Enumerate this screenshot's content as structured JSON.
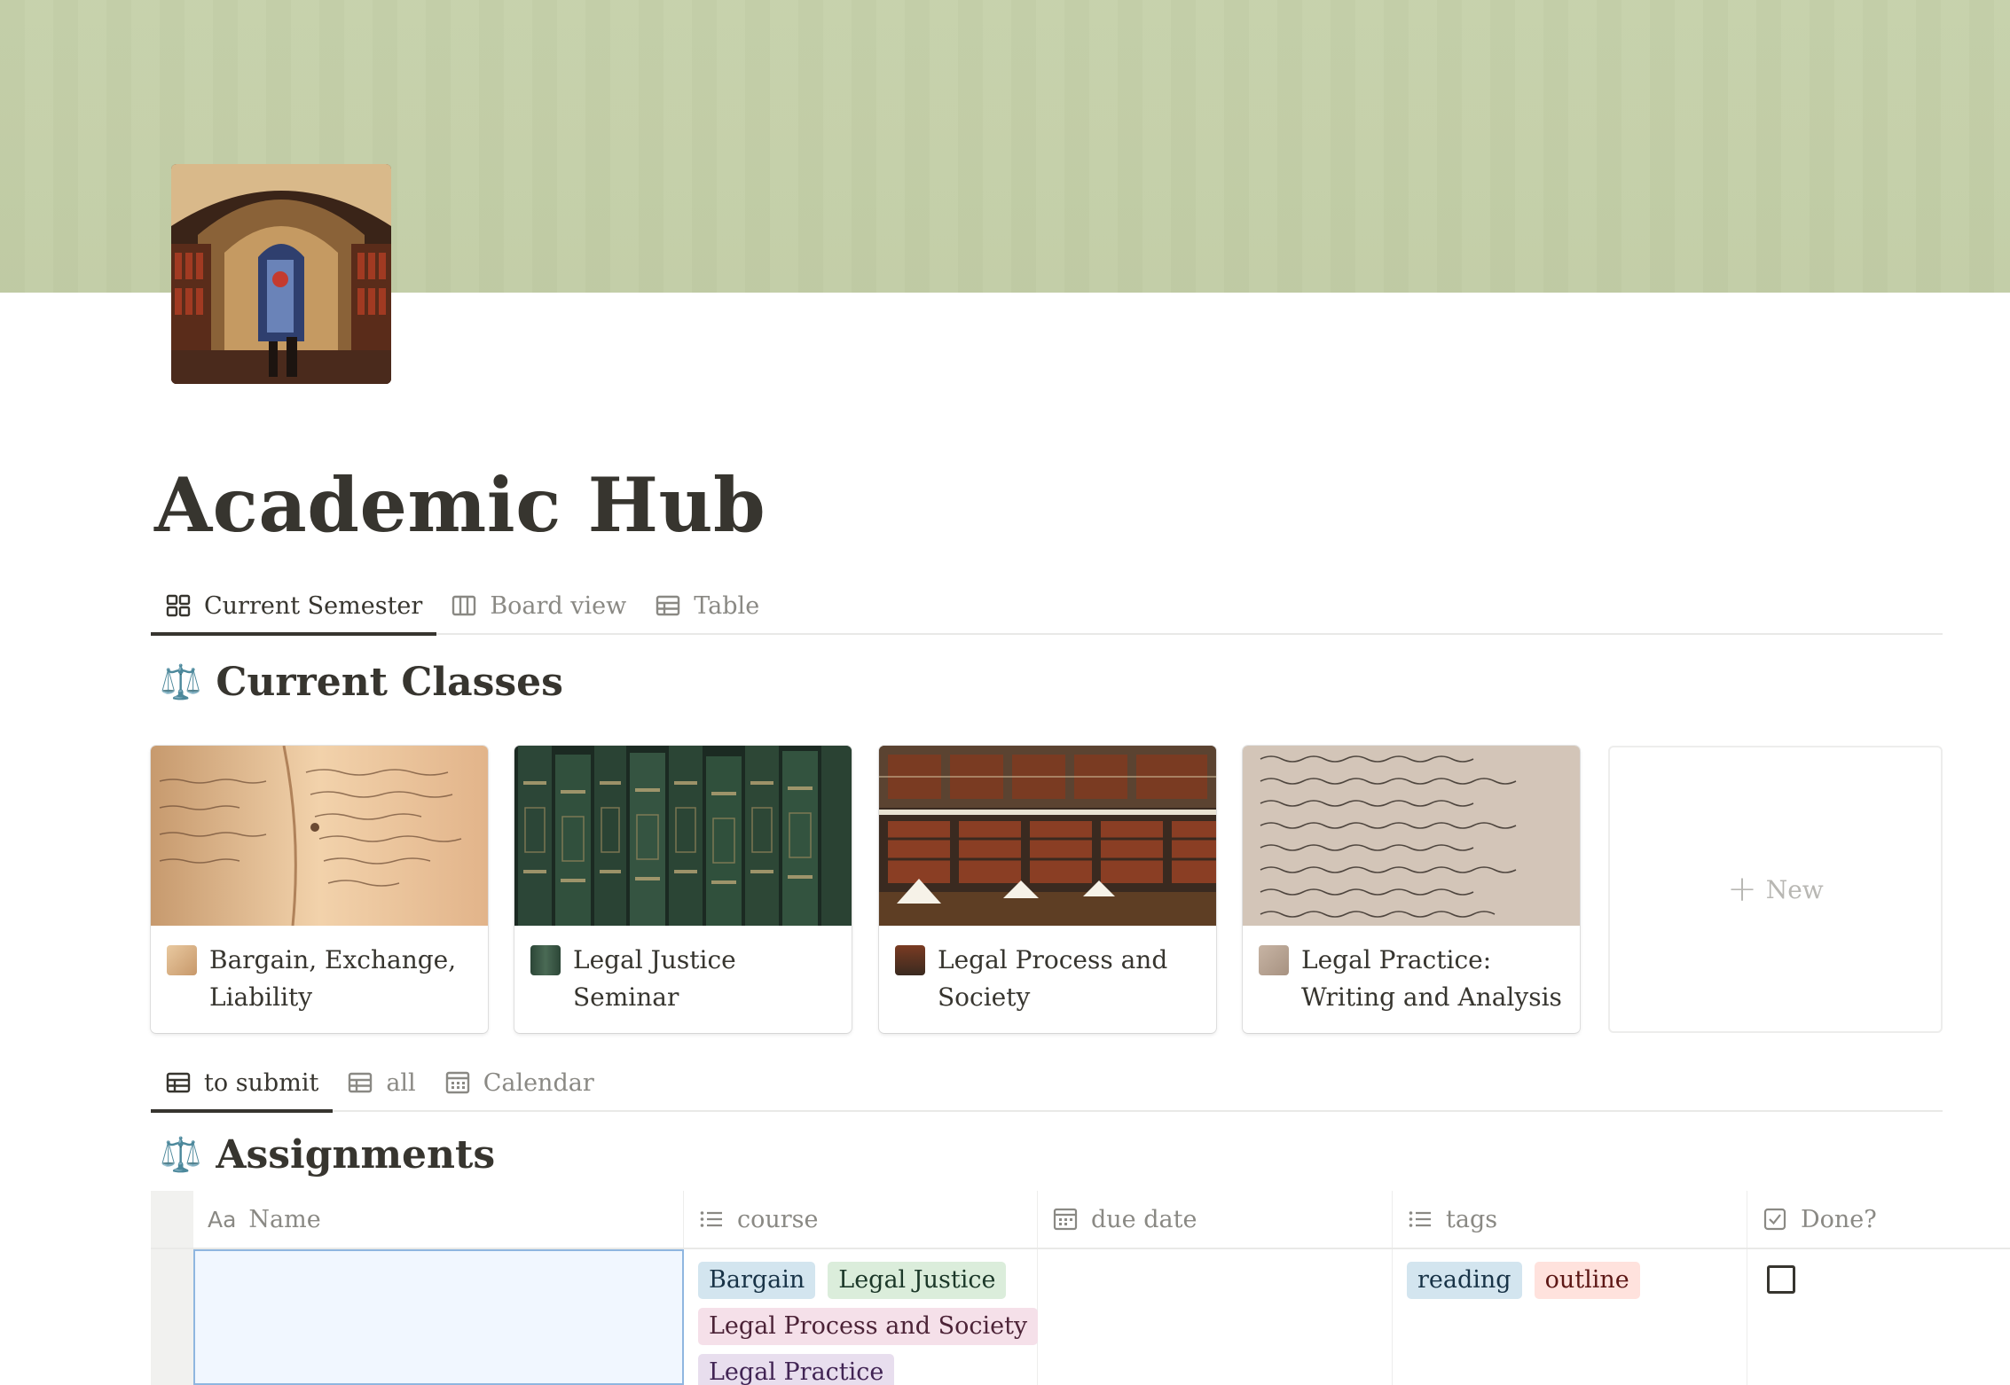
{
  "page": {
    "title": "Academic Hub"
  },
  "view_tabs": [
    {
      "label": "Current Semester",
      "icon": "gallery-icon",
      "active": true
    },
    {
      "label": "Board view",
      "icon": "board-icon",
      "active": false
    },
    {
      "label": "Table",
      "icon": "table-icon",
      "active": false
    }
  ],
  "classes_section": {
    "icon": "⚖️",
    "heading": "Current Classes",
    "cards": [
      {
        "title": "Bargain, Exchange, Liability",
        "theme": "manuscript"
      },
      {
        "title": "Legal Justice Seminar",
        "theme": "green-books"
      },
      {
        "title": "Legal Process and Society",
        "theme": "library"
      },
      {
        "title": "Legal Practice: Writing and Analysis",
        "theme": "handwriting"
      }
    ],
    "new_label": "New"
  },
  "assignment_tabs": [
    {
      "label": "to submit",
      "icon": "table-icon",
      "active": true
    },
    {
      "label": "all",
      "icon": "table-icon",
      "active": false
    },
    {
      "label": "Calendar",
      "icon": "calendar-icon",
      "active": false
    }
  ],
  "assignments_section": {
    "icon": "⚖️",
    "heading": "Assignments",
    "columns": [
      {
        "label": "Name",
        "icon": "text-property-icon"
      },
      {
        "label": "course",
        "icon": "multi-select-icon"
      },
      {
        "label": "due date",
        "icon": "date-property-icon"
      },
      {
        "label": "tags",
        "icon": "multi-select-icon"
      },
      {
        "label": "Done?",
        "icon": "checkbox-property-icon"
      }
    ],
    "rows": [
      {
        "name": "",
        "course": [
          {
            "label": "Bargain",
            "bg": "#d3e5ef",
            "fg": "#183347"
          },
          {
            "label": "Legal Justice",
            "bg": "#dbeddb",
            "fg": "#1c3829"
          },
          {
            "label": "Legal Process and Society",
            "bg": "#f5e0e9",
            "fg": "#4c2337"
          },
          {
            "label": "Legal Practice",
            "bg": "#e8deee",
            "fg": "#412454"
          }
        ],
        "due_date": "",
        "tags": [
          {
            "label": "reading",
            "bg": "#d3e5ef",
            "fg": "#183347"
          },
          {
            "label": "outline",
            "bg": "#ffe2dd",
            "fg": "#5d1715"
          }
        ],
        "done": false
      }
    ]
  },
  "colors": {
    "cover": "#c5d0aa",
    "text": "#37352f",
    "muted": "#8a8984",
    "accent_icon": "#e79a2c"
  }
}
